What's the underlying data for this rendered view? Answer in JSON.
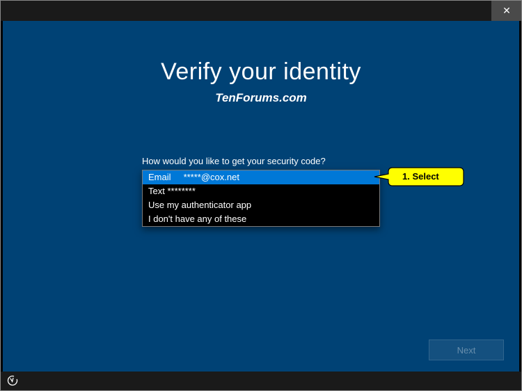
{
  "titlebar": {
    "close_label": "✕"
  },
  "page": {
    "title": "Verify your identity",
    "watermark": "TenForums.com",
    "prompt": "How would you like to get your security code?"
  },
  "dropdown": {
    "options": [
      {
        "label": "Email     *****@cox.net",
        "selected": true
      },
      {
        "label": "Text ********",
        "selected": false
      },
      {
        "label": "Use my authenticator app",
        "selected": false
      },
      {
        "label": "I don't have any of these",
        "selected": false
      }
    ]
  },
  "callout": {
    "text": "1. Select"
  },
  "footer": {
    "next_label": "Next"
  }
}
